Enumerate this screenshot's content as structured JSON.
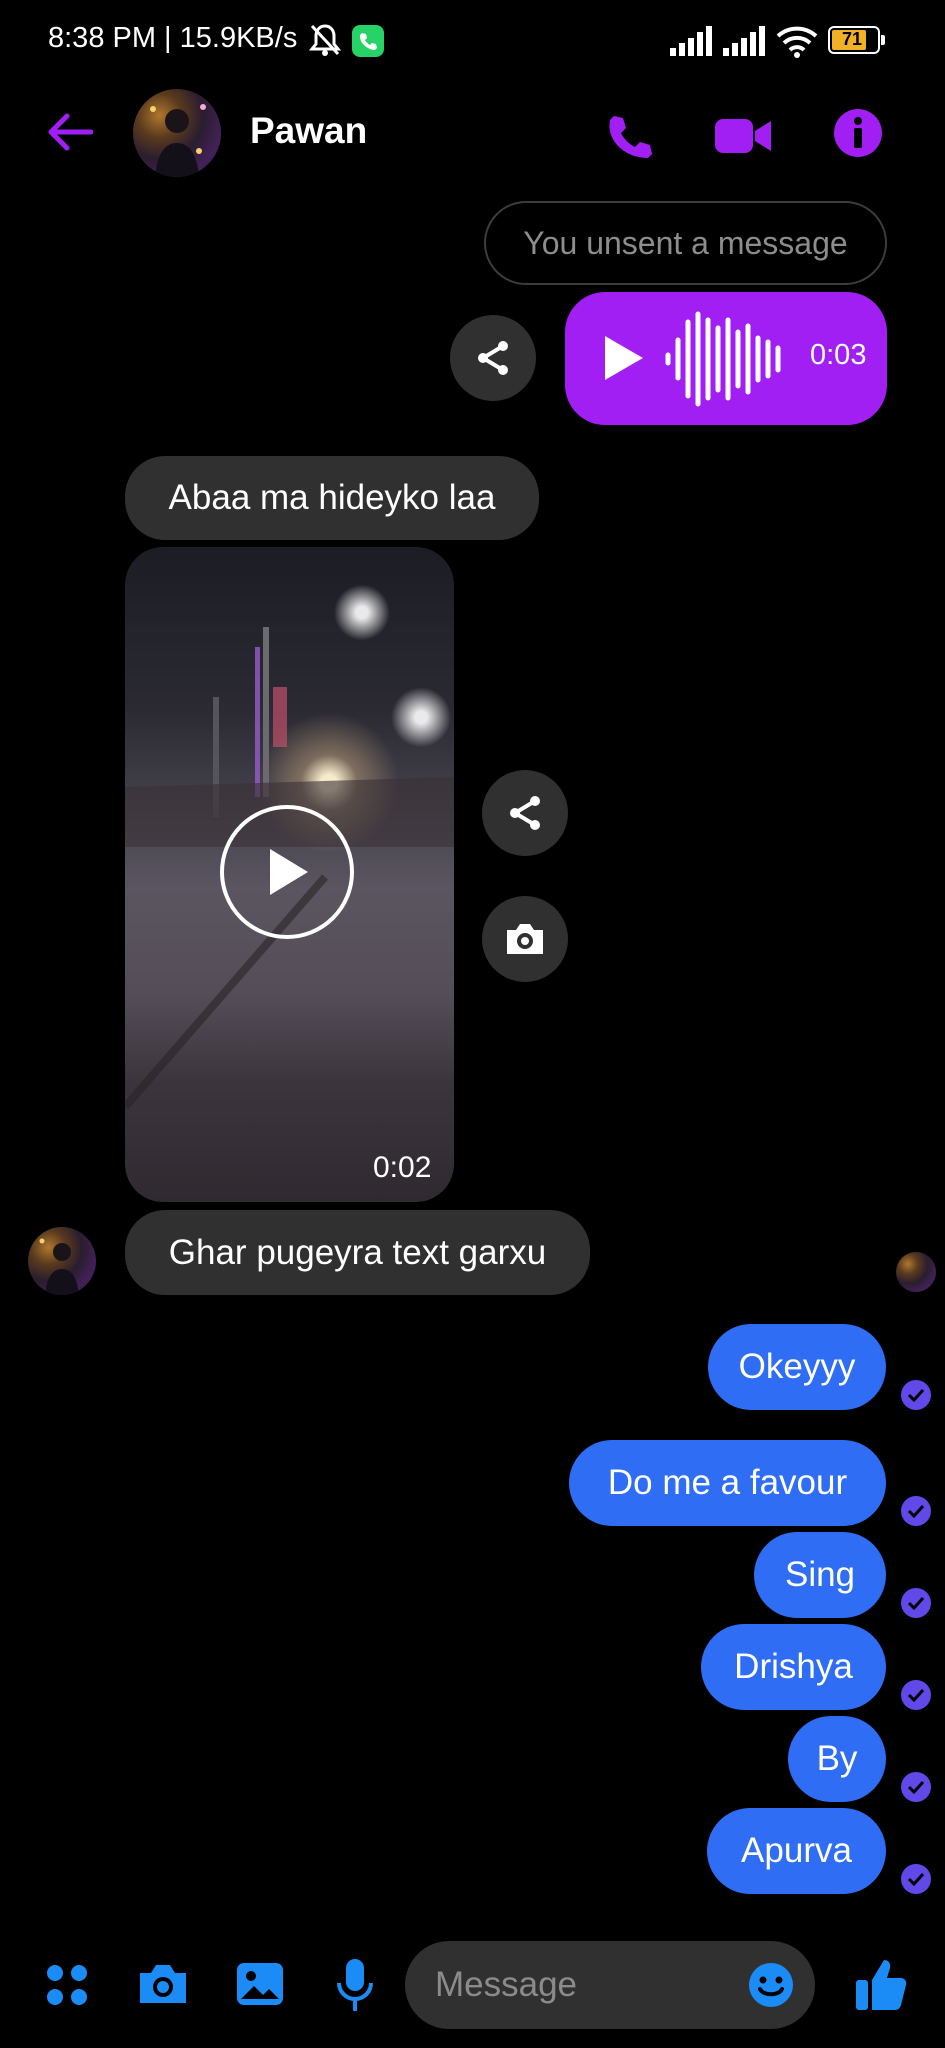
{
  "status_bar": {
    "time_speed": "8:38 PM | 15.9KB/s",
    "battery_level": "71"
  },
  "header": {
    "contact_name": "Pawan",
    "accent_color": "#a11ff2"
  },
  "conversation": {
    "unsent_notice": "You unsent a message",
    "voice_message": {
      "duration": "0:03"
    },
    "incoming": {
      "text_1": "Abaa ma hideyko laa",
      "video_duration": "0:02",
      "text_2": "Ghar pugeyra text garxu"
    },
    "outgoing": [
      {
        "text": "Okeyyy"
      },
      {
        "text": "Do me a favour"
      },
      {
        "text": "Sing"
      },
      {
        "text": "Drishya"
      },
      {
        "text": "By"
      },
      {
        "text": "Apurva"
      }
    ]
  },
  "composer": {
    "placeholder": "Message",
    "icon_color": "#1b8cf5"
  },
  "colors": {
    "outgoing_bubble": "#2f6ef4",
    "incoming_bubble": "#303030",
    "seen_check": "#6049e8"
  }
}
